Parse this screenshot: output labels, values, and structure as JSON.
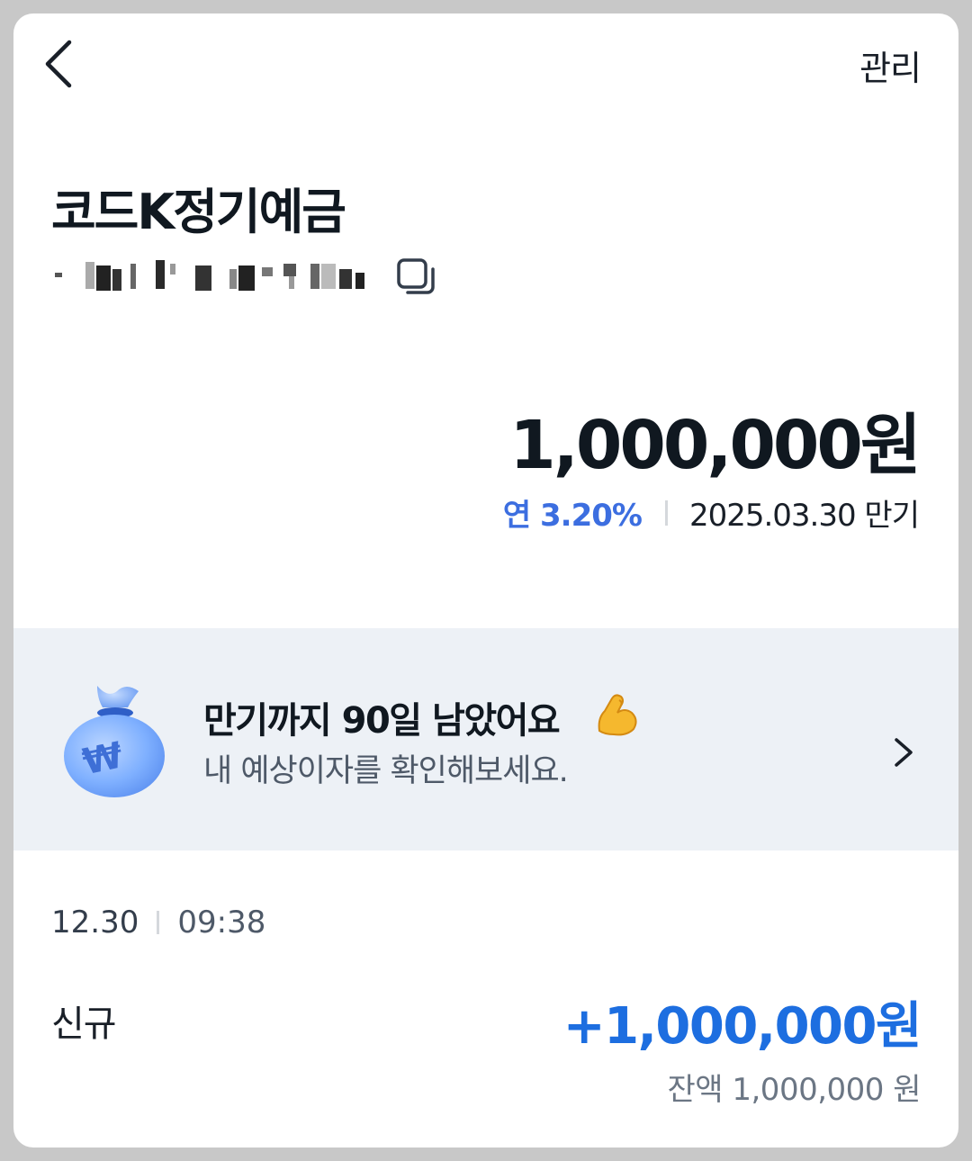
{
  "header": {
    "manage_label": "관리"
  },
  "account": {
    "product_name": "코드K정기예금",
    "balance": "1,000,000원",
    "rate": "연 3.20%",
    "maturity": "2025.03.30 만기"
  },
  "banner": {
    "title": "만기까지 90일 남았어요",
    "subtitle": "내 예상이자를 확인해보세요."
  },
  "transactions": [
    {
      "date": "12.30",
      "time": "09:38",
      "type": "신규",
      "amount": "+1,000,000원",
      "balance": "잔액 1,000,000 원"
    }
  ],
  "colors": {
    "accent_rate": "#3c6ee0",
    "deposit_amount": "#1d6ee0",
    "banner_bg": "#edf1f6"
  },
  "icons": [
    "back-arrow-icon",
    "copy-icon",
    "money-bag-icon",
    "flexed-biceps-icon",
    "chevron-right-icon"
  ]
}
